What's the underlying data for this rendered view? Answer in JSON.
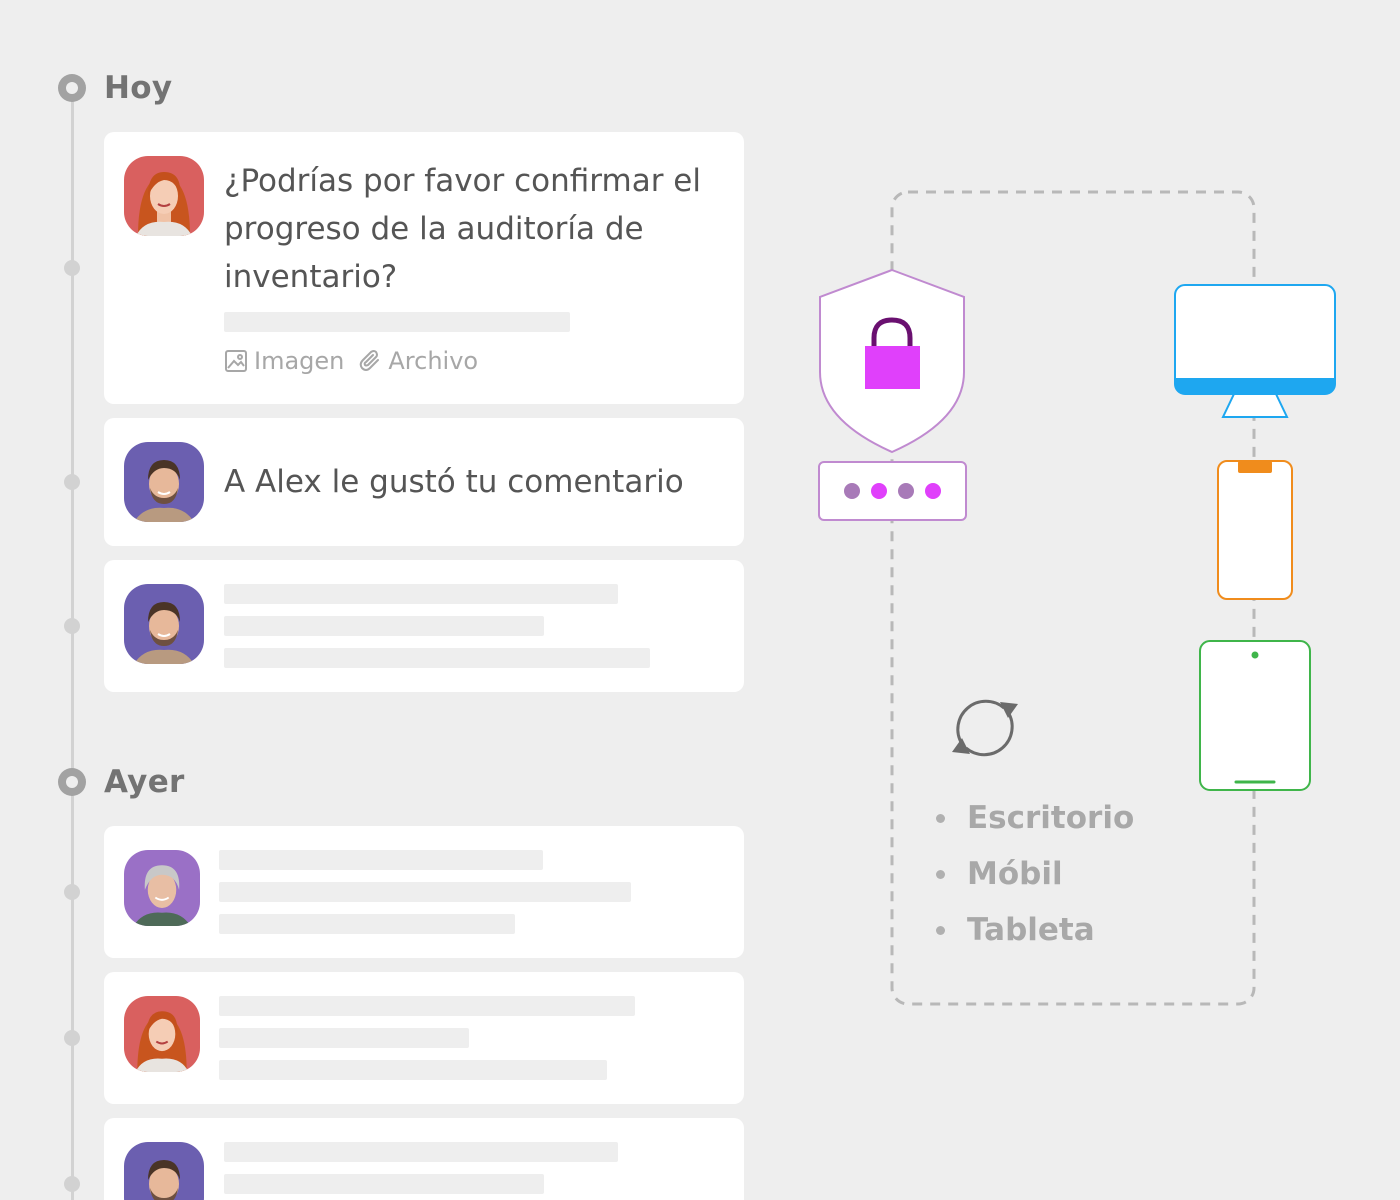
{
  "sections": {
    "today": {
      "title": "Hoy"
    },
    "yesterday": {
      "title": "Ayer"
    }
  },
  "cards": {
    "card1": {
      "message": "¿Podrías por favor confirmar el progreso de la auditoría de inventario?",
      "attachments": {
        "image_label": "Imagen",
        "file_label": "Archivo"
      }
    },
    "card2": {
      "message": "A Alex le gustó tu comentario"
    }
  },
  "devices": {
    "list": [
      "Escritorio",
      "Móbil",
      "Tableta"
    ]
  },
  "colors": {
    "background": "#eeeeee",
    "lock": "#e040fb",
    "shield_outline": "#c08ad0",
    "desktop": "#1ea7f0",
    "phone": "#f08c1c",
    "tablet": "#3fb54a",
    "password_dots": [
      "#a87ab8",
      "#e040fb",
      "#a87ab8",
      "#e040fb"
    ]
  },
  "icons": [
    "image-icon",
    "paperclip-icon",
    "shield-icon",
    "lock-icon",
    "sync-icon",
    "desktop-icon",
    "phone-icon",
    "tablet-icon"
  ]
}
